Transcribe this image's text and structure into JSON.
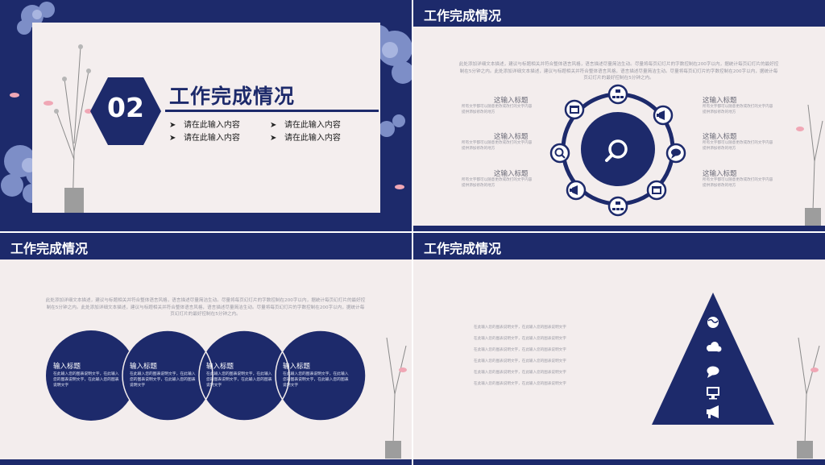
{
  "colors": {
    "navy": "#1d2a6b",
    "paper": "#f3eded",
    "white": "#ffffff"
  },
  "cover": {
    "number": "02",
    "title": "工作完成情况",
    "bullets": [
      "请在此输入内容",
      "请在此输入内容",
      "请在此输入内容",
      "请在此输入内容"
    ]
  },
  "slide2": {
    "header": "工作完成情况",
    "paragraph": "此处添加详细文本描述，建议与标题相关并符合整体语言风格，语言描述尽量简洁生动。尽量将每页幻灯片的字数控制在200字以内，据统计每页幻灯片的最好控制在5分钟之内。此处添加详细文本描述，建议与标题相关并符合整体语言风格，语言描述尽量简洁生动。尽量将每页幻灯片的字数控制在200字以内，据统计每页幻灯片的最好控制在5分钟之内。",
    "left_items": [
      {
        "title": "这输入标题",
        "text": "所有文字都可以随意更改或改打的文字内容提供添加修改的地方"
      },
      {
        "title": "这输入标题",
        "text": "所有文字都可以随意更改或改打的文字内容提供添加修改的地方"
      },
      {
        "title": "这输入标题",
        "text": "所有文字都可以随意更改或改打的文字内容提供添加修改的地方"
      }
    ],
    "right_items": [
      {
        "title": "这输入标题",
        "text": "所有文字都可以随意更改或改打的文字内容提供添加修改的地方"
      },
      {
        "title": "这输入标题",
        "text": "所有文字都可以随意更改或改打的文字内容提供添加修改的地方"
      },
      {
        "title": "这输入标题",
        "text": "所有文字都可以随意更改或改打的文字内容提供添加修改的地方"
      }
    ],
    "center_icon": "search-icon",
    "ring_icons": [
      "network-icon",
      "megaphone-icon",
      "chat-icon",
      "calendar-icon",
      "network-icon",
      "megaphone-icon",
      "search-icon",
      "calendar-icon"
    ]
  },
  "slide3": {
    "header": "工作完成情况",
    "paragraph": "此处添加详细文本描述，建议与标题相关并符合整体语言风格，语言描述尽量简洁生动。尽量将每页幻灯片的字数控制在200字以内，据统计每页幻灯片的最好控制在5分钟之内。此处添加详细文本描述，建议与标题相关并符合整体语言风格，语言描述尽量简洁生动。尽量将每页幻灯片的字数控制在200字以内，据统计每页幻灯片的最好控制在5分钟之内。",
    "circles": [
      {
        "title": "输入标题",
        "text": "在此输入您的图表说明文字，在此输入您的图表说明文字，在此输入您的图表说明文字"
      },
      {
        "title": "输入标题",
        "text": "在此输入您的图表说明文字，在此输入您的图表说明文字，在此输入您的图表说明文字"
      },
      {
        "title": "输入标题",
        "text": "在此输入您的图表说明文字，在此输入您的图表说明文字，在此输入您的图表说明文字"
      },
      {
        "title": "输入标题",
        "text": "在此输入您的图表说明文字，在此输入您的图表说明文字，在此输入您的图表说明文字"
      }
    ]
  },
  "slide4": {
    "header": "工作完成情况",
    "rows": [
      "在此输入您的图表说明文字，在此输入您的图表说明文字",
      "在此输入您的图表说明文字，在此输入您的图表说明文字",
      "在此输入您的图表说明文字，在此输入您的图表说明文字",
      "在此输入您的图表说明文字，在此输入您的图表说明文字",
      "在此输入您的图表说明文字，在此输入您的图表说明文字",
      "在此输入您的图表说明文字，在此输入您的图表说明文字"
    ],
    "triangle_icons": [
      "globe-icon",
      "cloud-icon",
      "chat-icon",
      "monitor-icon",
      "megaphone-icon"
    ]
  }
}
